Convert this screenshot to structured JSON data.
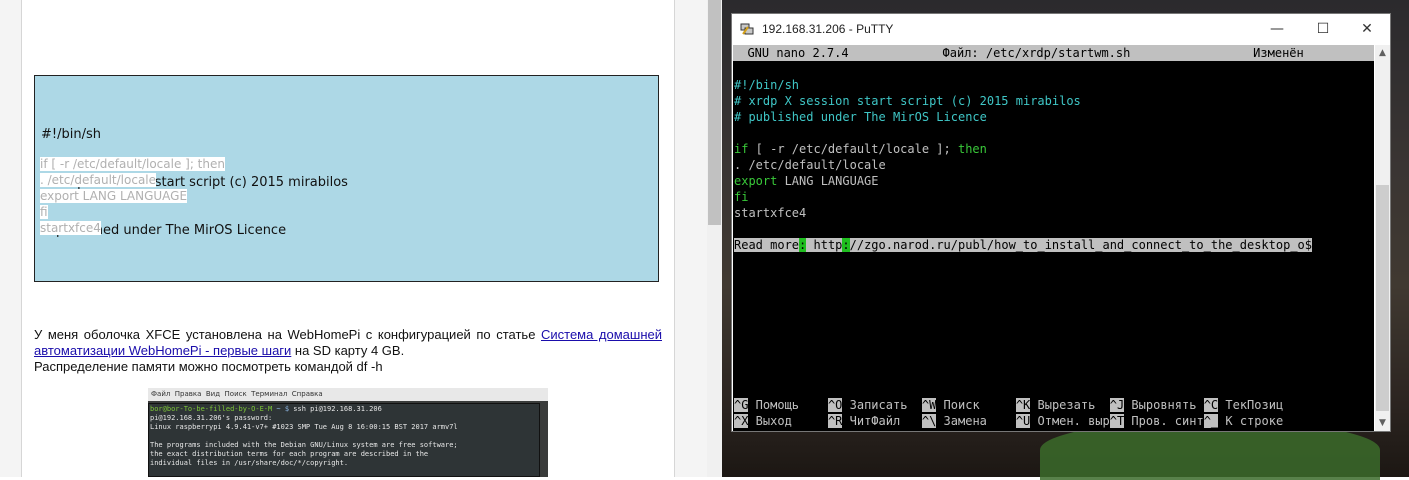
{
  "browser": {
    "code_box": {
      "header_lines": [
        "#!/bin/sh",
        "# xrdp X session start script (c) 2015 mirabilos",
        "# published under The MirOS Licence"
      ],
      "selected_lines": [
        "if [ -r /etc/default/locale ]; then",
        ". /etc/default/locale",
        "export LANG LANGUAGE",
        "fi",
        "startxfce4"
      ]
    },
    "paragraph": {
      "text_before": "У меня оболочка XFCE установлена на WebHomePi с конфигурацией по статье ",
      "link_text": "Система домашней автоматизации WebHomePi - первые шаги",
      "text_after": " на SD карту 4 GB.",
      "line2": "Распределение памяти можно посмотреть командой df -h"
    },
    "screenshot": {
      "menu": "Файл  Правка  Вид  Поиск  Терминал  Справка",
      "prompt_user": "bor@bor-To-be-filled-by-O-E-M",
      "prompt_path": " ~ $",
      "prompt_cmd": " ssh pi@192.168.31.206",
      "lines": [
        "pi@192.168.31.206's password:",
        "Linux raspberrypi 4.9.41-v7+ #1023 SMP Tue Aug 8 16:00:15 BST 2017 armv7l",
        "",
        "The programs included with the Debian GNU/Linux system are free software;",
        "the exact distribution terms for each program are described in the",
        "individual files in /usr/share/doc/*/copyright."
      ]
    }
  },
  "putty": {
    "title": "192.168.31.206 - PuTTY",
    "window_buttons": {
      "minimize": "—",
      "maximize": "☐",
      "close": "✕"
    },
    "nano_header": "  GNU nano 2.7.4             Файл: /etc/xrdp/startwm.sh                 Изменён  ",
    "file_lines": [
      {
        "text": "#!/bin/sh"
      },
      {
        "text": "# xrdp X session start script (c) 2015 mirabilos"
      },
      {
        "text": "# published under The MirOS Licence"
      }
    ],
    "code": {
      "if_kw": "if",
      "if_rest": " [ -r /etc/default/locale ]; ",
      "then_kw": "then",
      "source": ". /etc/default/locale",
      "export_kw": "export",
      "export_rest": " LANG LANGUAGE",
      "fi_kw": "fi",
      "startx": "startxfce4"
    },
    "read_more": {
      "part1": "Read more",
      "part2": ":",
      "part3": " http",
      "part4": ":",
      "part5": "//zgo.narod.ru/publ/how_to_install_and_connect_to_the_desktop_o$"
    },
    "shortcuts_row1": [
      {
        "key": "^G",
        "label": " Помощь    "
      },
      {
        "key": "^O",
        "label": " Записать  "
      },
      {
        "key": "^W",
        "label": " Поиск     "
      },
      {
        "key": "^K",
        "label": " Вырезать  "
      },
      {
        "key": "^J",
        "label": " Выровнять "
      },
      {
        "key": "^C",
        "label": " ТекПозиц"
      }
    ],
    "shortcuts_row2": [
      {
        "key": "^X",
        "label": " Выход     "
      },
      {
        "key": "^R",
        "label": " ЧитФайл   "
      },
      {
        "key": "^\\",
        "label": " Замена    "
      },
      {
        "key": "^U",
        "label": " Отмен. выр"
      },
      {
        "key": "^T",
        "label": " Пров. синт"
      },
      {
        "key": "^_",
        "label": " К строке"
      }
    ]
  }
}
